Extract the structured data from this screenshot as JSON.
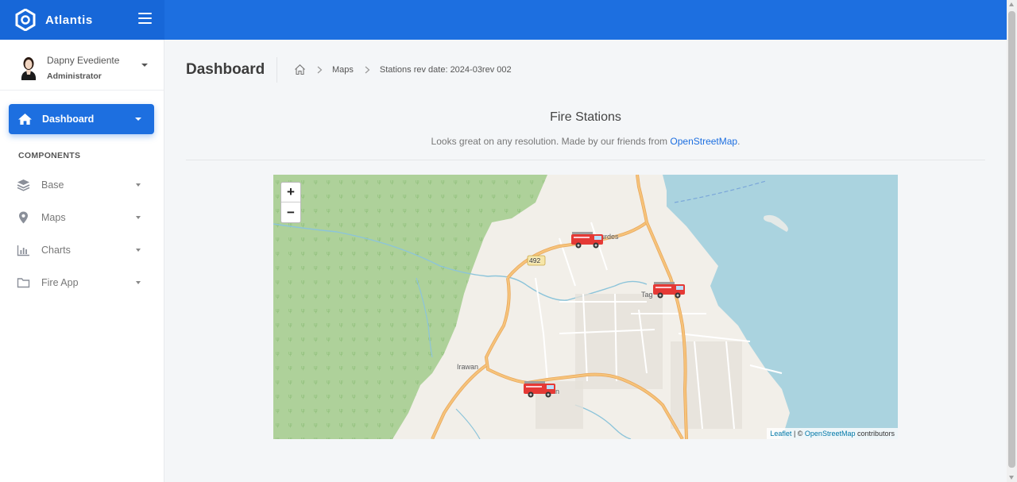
{
  "brand": {
    "name": "Atlantis"
  },
  "user": {
    "name": "Dapny Evediente",
    "role": "Administrator"
  },
  "sidebar": {
    "active": {
      "label": "Dashboard",
      "icon": "home-icon"
    },
    "section_title": "COMPONENTS",
    "items": [
      {
        "label": "Base",
        "icon": "layers-icon"
      },
      {
        "label": "Maps",
        "icon": "map-pin-icon"
      },
      {
        "label": "Charts",
        "icon": "bar-chart-icon"
      },
      {
        "label": "Fire App",
        "icon": "folder-icon"
      }
    ]
  },
  "page": {
    "title": "Dashboard",
    "breadcrumb": {
      "maps": "Maps",
      "current": "Stations rev date: 2024-03rev 002"
    }
  },
  "card": {
    "title": "Fire Stations",
    "subtitle": "Looks great on any resolution. Made by our friends from",
    "subtitle_link": "OpenStreetMap",
    "subtitle_end": "."
  },
  "map": {
    "zoom_in": "+",
    "zoom_out": "−",
    "attribution": {
      "leaflet": "Leaflet",
      "sep": " | © ",
      "osm": "OpenStreetMap",
      "suffix": " contributors"
    },
    "places": {
      "lourdes": "urdes",
      "tag": "Tag",
      "irawan": "Irawan",
      "road": "492",
      "san": "an"
    },
    "markers": [
      "fire-truck-icon",
      "fire-truck-icon",
      "fire-truck-icon"
    ]
  },
  "colors": {
    "accent": "#1d6fe0",
    "forest": "#aed19a",
    "water": "#aad3df",
    "road": "#f6c37a"
  }
}
